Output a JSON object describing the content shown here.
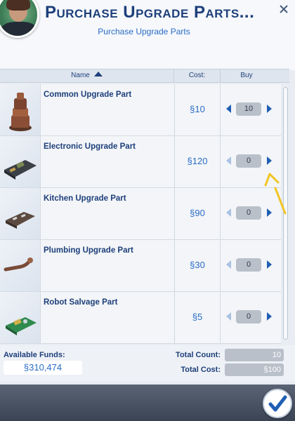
{
  "header": {
    "title": "Purchase Upgrade Parts...",
    "subtitle": "Purchase Upgrade Parts",
    "close_icon": "close-icon"
  },
  "columns": {
    "name": "Name",
    "cost": "Cost:",
    "buy": "Buy",
    "sort": "ascending"
  },
  "items": [
    {
      "name": "Common Upgrade Part",
      "cost": "§10",
      "qty": "10",
      "icon": "common-part-icon"
    },
    {
      "name": "Electronic Upgrade Part",
      "cost": "§120",
      "qty": "0",
      "icon": "electronic-part-icon"
    },
    {
      "name": "Kitchen Upgrade Part",
      "cost": "§90",
      "qty": "0",
      "icon": "kitchen-part-icon"
    },
    {
      "name": "Plumbing Upgrade Part",
      "cost": "§30",
      "qty": "0",
      "icon": "plumbing-part-icon"
    },
    {
      "name": "Robot Salvage Part",
      "cost": "§5",
      "qty": "0",
      "icon": "robot-salvage-icon"
    }
  ],
  "footer": {
    "funds_label": "Available Funds:",
    "funds_value": "§310,474",
    "total_count_label": "Total Count:",
    "total_count_value": "10",
    "total_cost_label": "Total Cost:",
    "total_cost_value": "§100"
  },
  "colors": {
    "title": "#1d3f7a",
    "accent": "#2a6cc7",
    "annotation": "#f2c522"
  }
}
